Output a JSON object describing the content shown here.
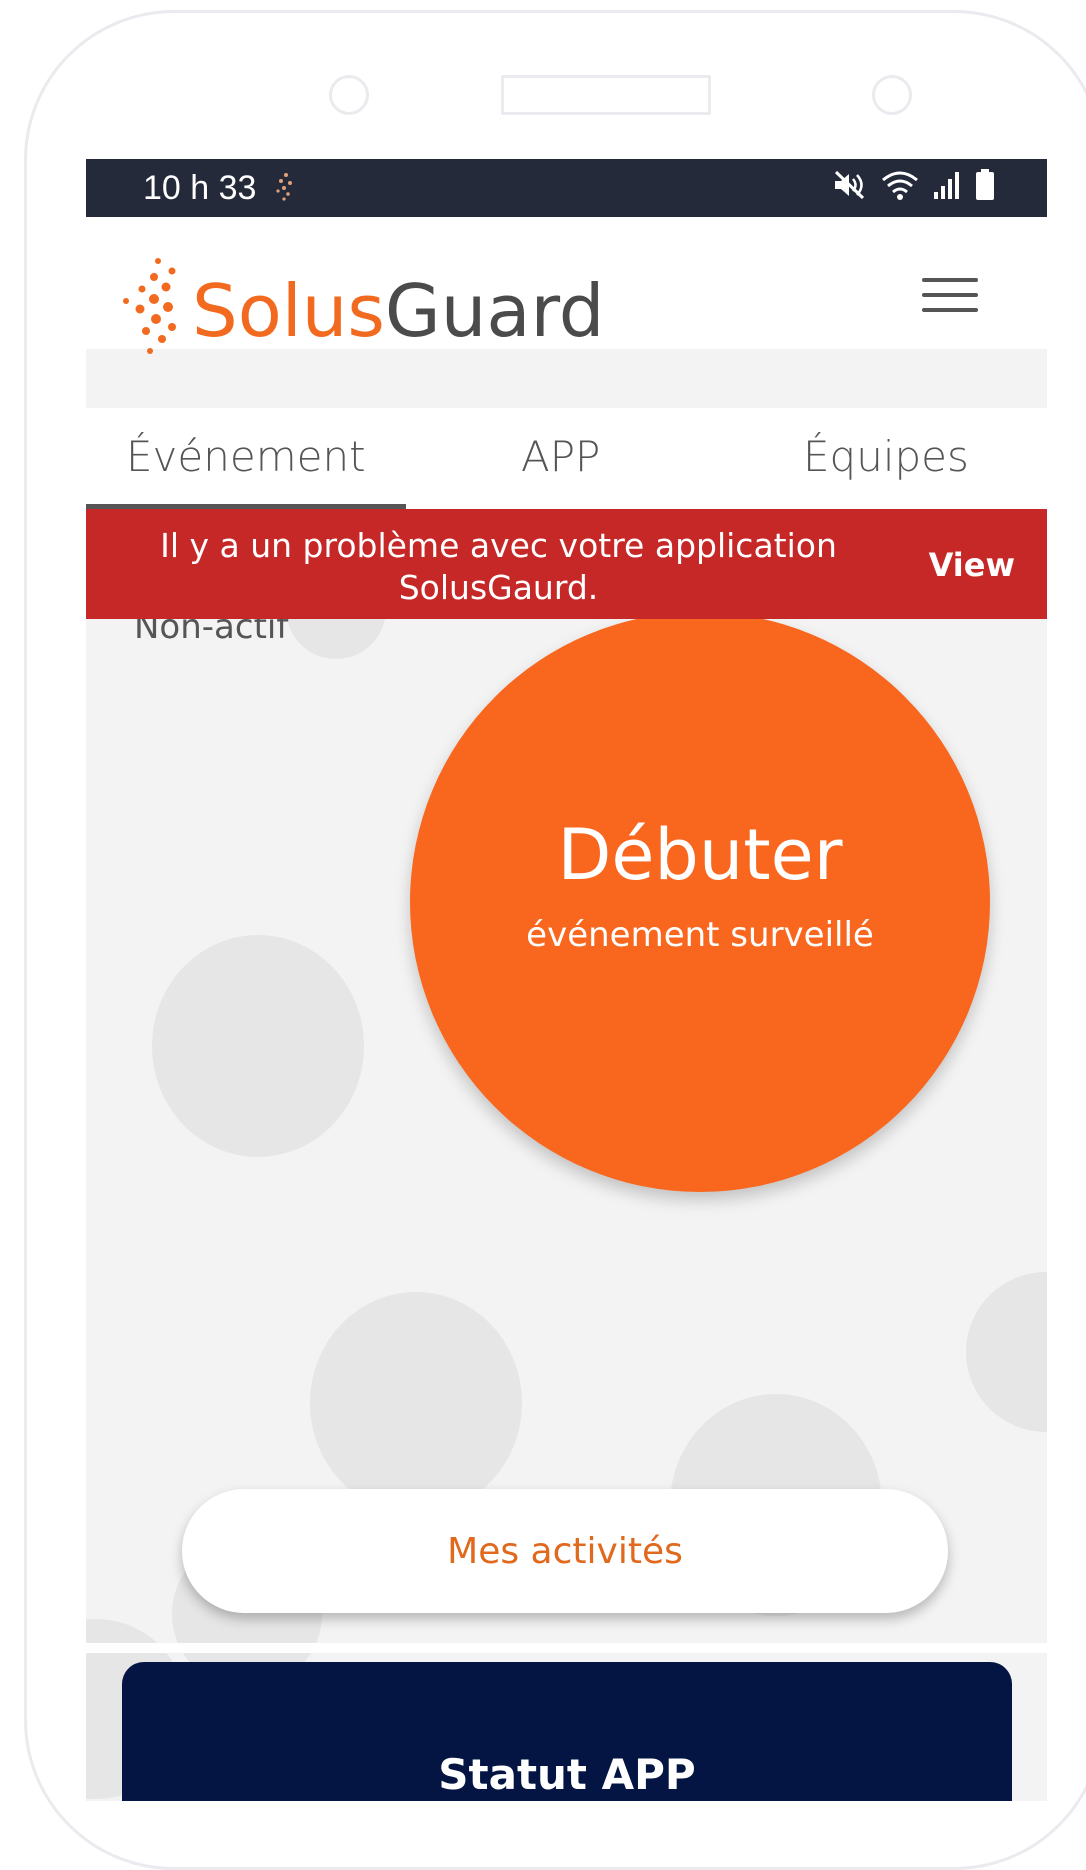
{
  "status_bar": {
    "time": "10 h 33"
  },
  "brand": {
    "part1": "Solus",
    "part2": "Guard",
    "accent_color": "#f26a1f"
  },
  "tabs": [
    {
      "label": "Événement",
      "active": true
    },
    {
      "label": "APP",
      "active": false
    },
    {
      "label": "Équipes",
      "active": false
    }
  ],
  "alert": {
    "message": "Il y a un problème avec votre application SolusGaurd.",
    "action": "View",
    "color": "#c62828"
  },
  "event": {
    "state": "Non-actif",
    "start_title": "Débuter",
    "start_subtitle": "événement surveillé",
    "button_color": "#f9661e"
  },
  "activities_button": {
    "label": "Mes activités"
  },
  "status_panel": {
    "title": "Statut APP",
    "color": "#041443"
  },
  "icons": {
    "notification": "activity-dots-icon",
    "mute": "mute-icon",
    "wifi": "wifi-icon",
    "signal": "signal-icon",
    "battery": "battery-icon",
    "menu": "hamburger-menu-icon"
  }
}
